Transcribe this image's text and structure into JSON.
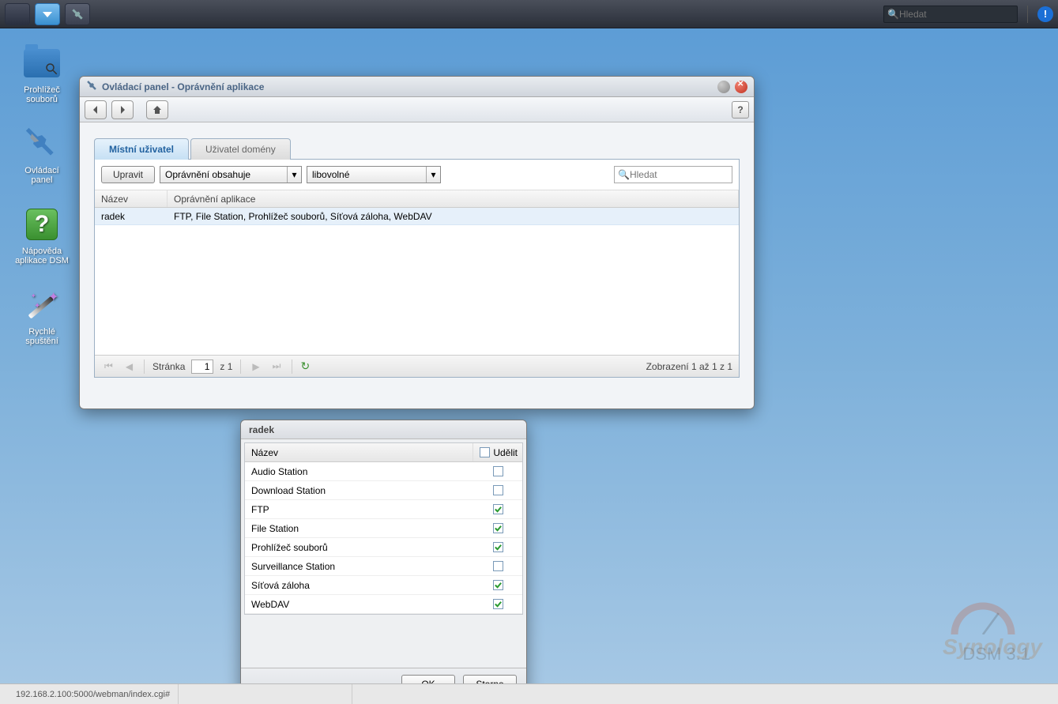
{
  "taskbar": {
    "search_placeholder": "Hledat"
  },
  "desktop": {
    "icons": [
      {
        "label": "Prohlížeč souborů"
      },
      {
        "label": "Ovládací panel"
      },
      {
        "label": "Nápověda aplikace DSM"
      },
      {
        "label": "Rychlé spuštění"
      }
    ]
  },
  "window": {
    "title": "Ovládací panel - Oprávnění aplikace",
    "tabs": {
      "local": "Místní uživatel",
      "domain": "Uživatel domény"
    },
    "filter": {
      "edit_btn": "Upravit",
      "permissions_contains": "Oprávnění obsahuje",
      "any": "libovolné",
      "search_placeholder": "Hledat"
    },
    "grid": {
      "col_name": "Název",
      "col_perms": "Oprávnění aplikace",
      "rows": [
        {
          "name": "radek",
          "perms": "FTP, File Station, Prohlížeč souborů, Síťová záloha, WebDAV"
        }
      ]
    },
    "pager": {
      "page_label": "Stránka",
      "page_num": "1",
      "of": "z 1",
      "status": "Zobrazení 1 až 1 z 1"
    }
  },
  "dialog": {
    "title": "radek",
    "col_name": "Název",
    "col_grant": "Udělit",
    "rows": [
      {
        "name": "Audio Station",
        "checked": false
      },
      {
        "name": "Download Station",
        "checked": false
      },
      {
        "name": "FTP",
        "checked": true
      },
      {
        "name": "File Station",
        "checked": true
      },
      {
        "name": "Prohlížeč souborů",
        "checked": true
      },
      {
        "name": "Surveillance Station",
        "checked": false
      },
      {
        "name": "Síťová záloha",
        "checked": true
      },
      {
        "name": "WebDAV",
        "checked": true
      }
    ],
    "ok": "OK",
    "cancel": "Storno"
  },
  "branding": {
    "logo": "Synology",
    "version": "DSM 3.1"
  },
  "statusbar": {
    "url": "192.168.2.100:5000/webman/index.cgi#"
  }
}
